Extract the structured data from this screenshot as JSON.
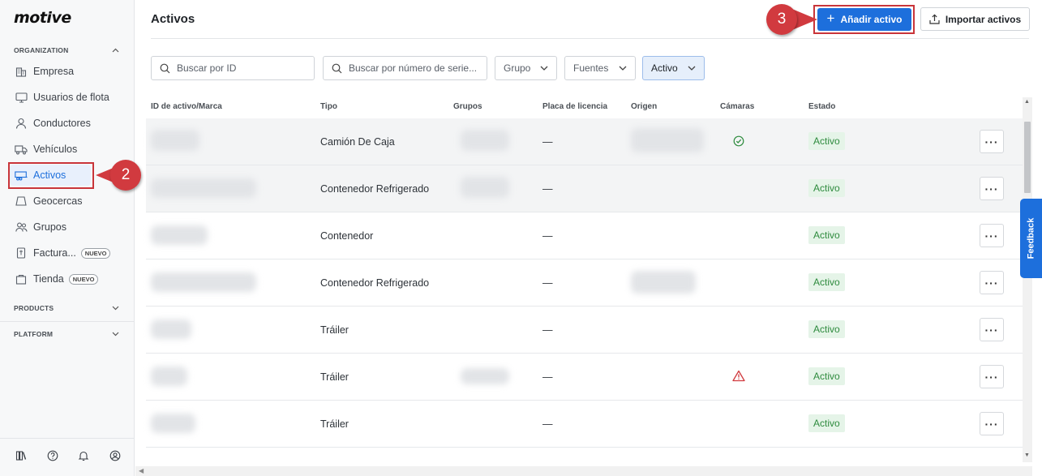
{
  "brand": "motive",
  "sidebar": {
    "sections": {
      "organization": "ORGANIZATION",
      "products": "PRODUCTS",
      "platform": "PLATFORM"
    },
    "items": [
      {
        "label": "Empresa",
        "icon": "building-icon"
      },
      {
        "label": "Usuarios de flota",
        "icon": "monitor-icon"
      },
      {
        "label": "Conductores",
        "icon": "person-icon"
      },
      {
        "label": "Vehículos",
        "icon": "truck-icon"
      },
      {
        "label": "Activos",
        "icon": "trailer-icon",
        "active": true
      },
      {
        "label": "Geocercas",
        "icon": "geofence-icon"
      },
      {
        "label": "Grupos",
        "icon": "group-icon"
      },
      {
        "label": "Factura...",
        "icon": "fuel-card-icon",
        "badge": "NUEVO"
      },
      {
        "label": "Tienda",
        "icon": "shopping-bag-icon",
        "badge": "NUEVO"
      }
    ],
    "bottom_icons": [
      "library-icon",
      "help-icon",
      "bell-icon",
      "profile-icon"
    ]
  },
  "markers": {
    "activos": "2",
    "add": "3"
  },
  "header": {
    "title": "Activos",
    "add_button": "Añadir activo",
    "import_button": "Importar activos"
  },
  "filters": {
    "search_id": "Buscar por ID",
    "search_serial": "Buscar por número de serie...",
    "group": "Grupo",
    "sources": "Fuentes",
    "status": "Activo"
  },
  "table": {
    "columns": [
      "ID de activo/Marca",
      "Tipo",
      "Grupos",
      "Placa de licencia",
      "Origen",
      "Cámaras",
      "Estado"
    ],
    "rows": [
      {
        "tipo": "Camión De Caja",
        "placa": "—",
        "camera": "ok",
        "estado": "Activo"
      },
      {
        "tipo": "Contenedor Refrigerado",
        "placa": "—",
        "camera": "",
        "estado": "Activo"
      },
      {
        "tipo": "Contenedor",
        "placa": "—",
        "camera": "",
        "estado": "Activo"
      },
      {
        "tipo": "Contenedor Refrigerado",
        "placa": "—",
        "camera": "",
        "estado": "Activo"
      },
      {
        "tipo": "Tráiler",
        "placa": "—",
        "camera": "",
        "estado": "Activo"
      },
      {
        "tipo": "Tráiler",
        "placa": "—",
        "camera": "warning",
        "estado": "Activo"
      },
      {
        "tipo": "Tráiler",
        "placa": "—",
        "camera": "",
        "estado": "Activo"
      }
    ],
    "more_label": "···"
  },
  "feedback": "Feedback",
  "colors": {
    "accent": "#1d6fdc",
    "marker": "#d13a3f",
    "status_bg": "#e5f4e8",
    "status_text": "#2e8b3e"
  }
}
